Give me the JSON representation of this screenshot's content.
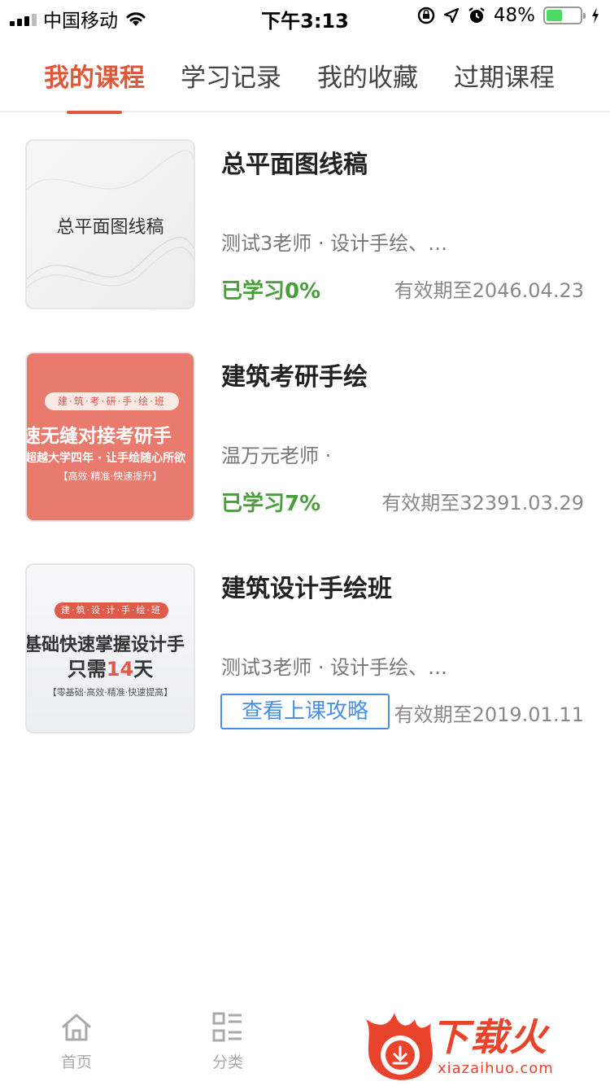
{
  "status_bar": {
    "carrier": "中国移动",
    "time": "下午3:13",
    "battery_pct": "48%",
    "battery_level": 0.48
  },
  "tabs": [
    {
      "label": "我的课程",
      "active": true
    },
    {
      "label": "学习记录",
      "active": false
    },
    {
      "label": "我的收藏",
      "active": false
    },
    {
      "label": "过期课程",
      "active": false
    }
  ],
  "courses": [
    {
      "title": "总平面图线稿",
      "thumb_text": "总平面图线稿",
      "meta": "测试3老师 · 设计手绘、…",
      "progress": "已学习0%",
      "expiry": "有效期至2046.04.23"
    },
    {
      "title": "建筑考研手绘",
      "thumb_pill": "建·筑·考·研·手·绘·班",
      "thumb_headline": "速无缝对接考研手",
      "thumb_sub": "超越大学四年 · 让手绘随心所欲",
      "thumb_tag": "【高效·精准·快速提升】",
      "meta": "温万元老师 ·",
      "progress": "已学习7%",
      "expiry": "有效期至32391.03.29"
    },
    {
      "title": "建筑设计手绘班",
      "thumb_pill": "建·筑·设·计·手·绘·班",
      "thumb_headline": "基础快速掌握设计手",
      "thumb_days_prefix": "只需",
      "thumb_days_num": "14",
      "thumb_days_suffix": "天",
      "thumb_tag": "【零基础·高效·精准·快速提高】",
      "meta": "测试3老师 · 设计手绘、…",
      "button": "查看上课攻略",
      "expiry": "有效期至2019.01.11"
    }
  ],
  "bottom_nav": [
    {
      "label": "首页",
      "icon": "home-icon"
    },
    {
      "label": "分类",
      "icon": "category-icon"
    }
  ],
  "watermark": {
    "text": "下载火",
    "url": "xiazaihuo.com"
  },
  "colors": {
    "accent": "#e0583a",
    "progress_green": "#4a9e3c",
    "link_blue": "#4a90e2"
  }
}
